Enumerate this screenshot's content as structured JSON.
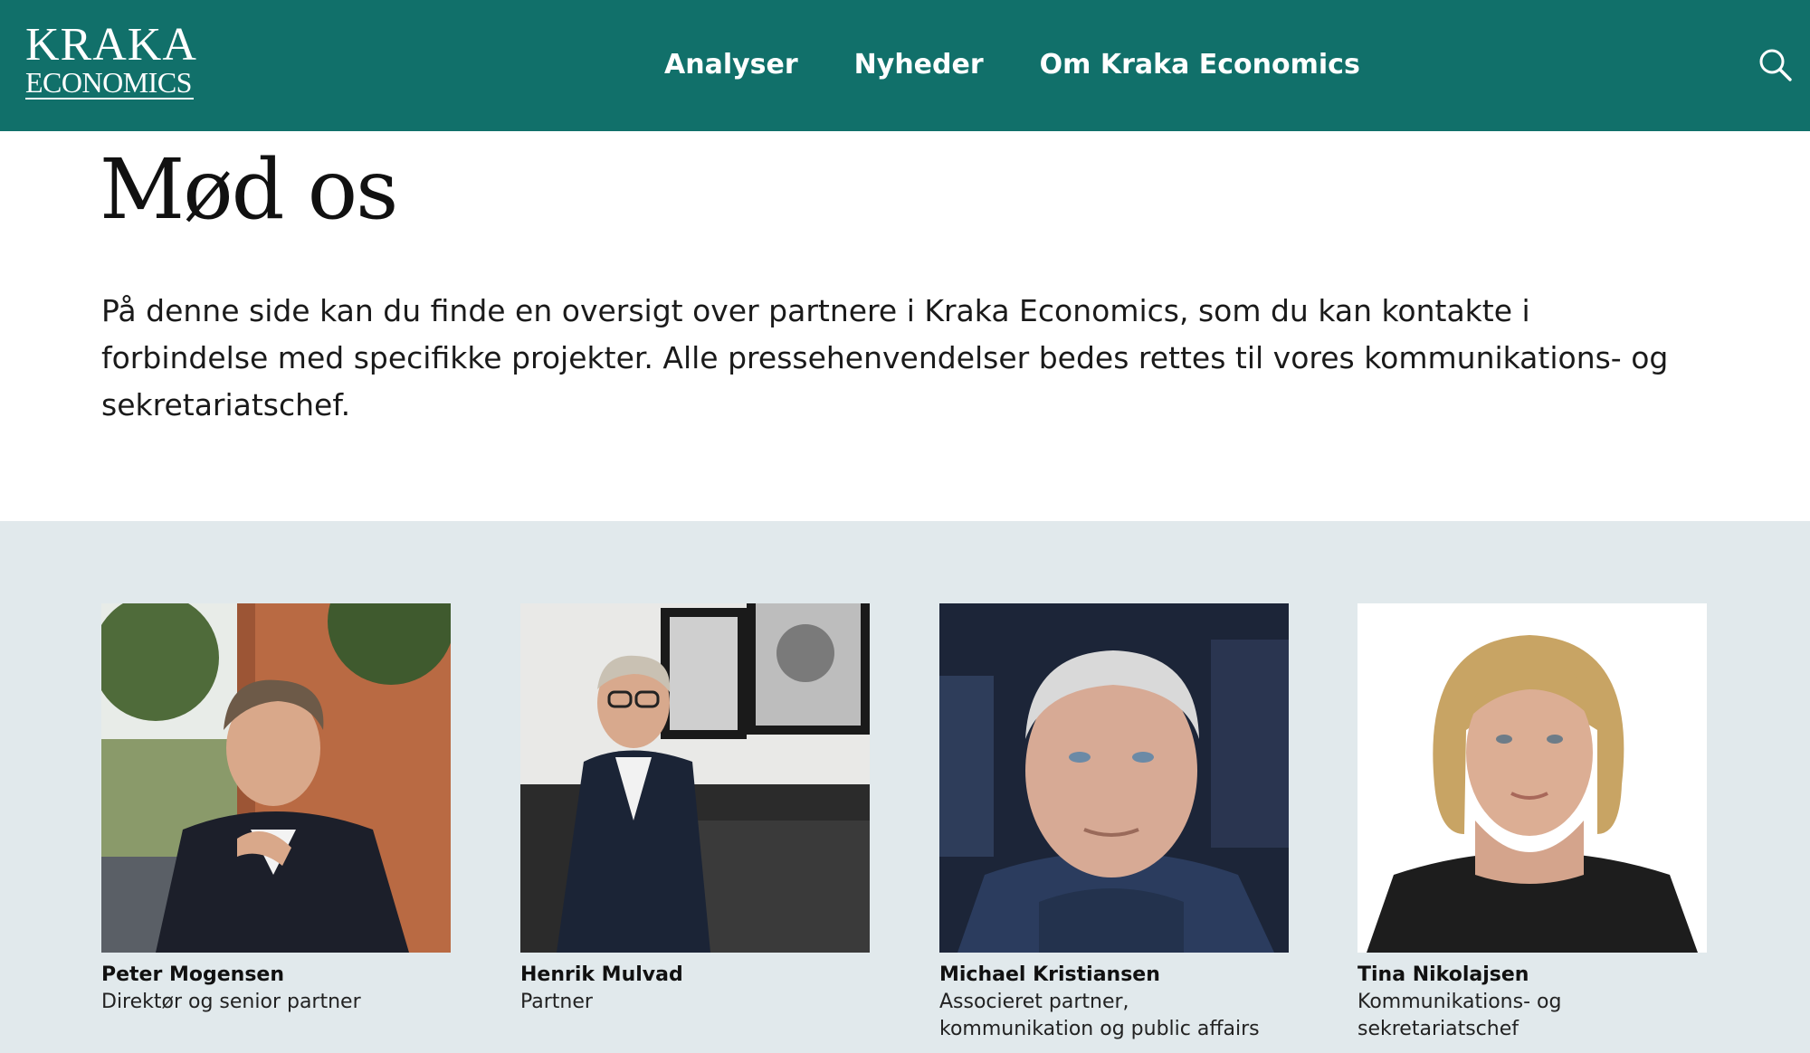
{
  "header": {
    "logo_top": "KRAKA",
    "logo_bottom": "ECONOMICS",
    "nav": [
      "Analyser",
      "Nyheder",
      "Om Kraka Economics"
    ],
    "search_icon": "search-icon",
    "background": "#11706a"
  },
  "page": {
    "title": "Mød os",
    "intro": "På denne side kan du finde en oversigt over partnere i Kraka Economics, som du kan kontakte i forbindelse med specifikke projekter. Alle pressehenvendelser bedes rettes til vores kommunikations- og sekretariatschef."
  },
  "team": {
    "background": "#e1e9ec",
    "people": [
      {
        "name": "Peter Mogensen",
        "role_lines": [
          "Direktør og senior partner"
        ]
      },
      {
        "name": "Henrik Mulvad",
        "role_lines": [
          "Partner"
        ]
      },
      {
        "name": "Michael Kristiansen",
        "role_lines": [
          "Associeret partner,",
          "kommunikation og public affairs"
        ]
      },
      {
        "name": "Tina Nikolajsen",
        "role_lines": [
          "Kommunikations- og",
          "sekretariatschef"
        ]
      }
    ]
  }
}
